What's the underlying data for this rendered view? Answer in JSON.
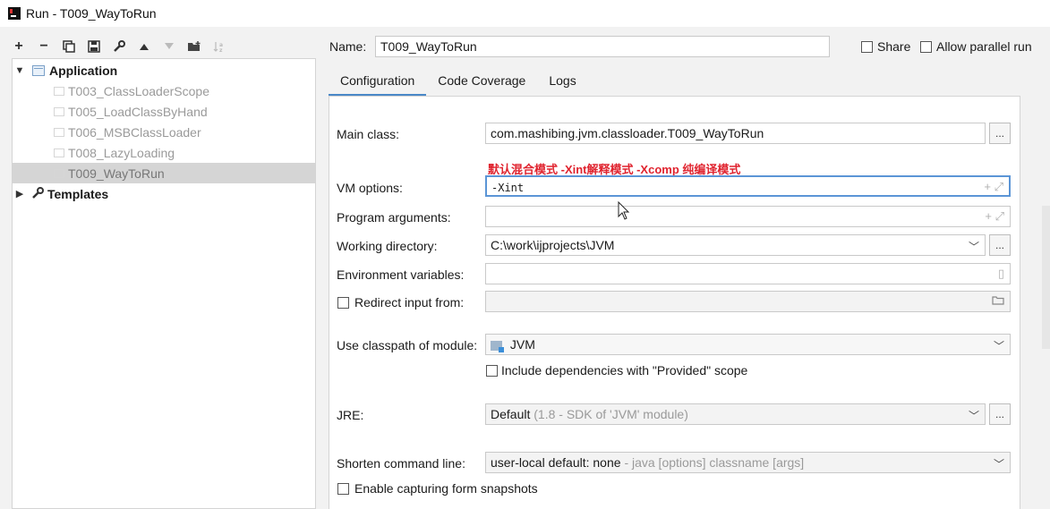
{
  "window": {
    "title": "Run - T009_WayToRun"
  },
  "toolbar": {
    "buttons": [
      "add",
      "remove",
      "copy",
      "save",
      "edit-defaults",
      "move-up",
      "move-down",
      "new-folder",
      "sort"
    ]
  },
  "tree": {
    "application_label": "Application",
    "items": [
      "T003_ClassLoaderScope",
      "T005_LoadClassByHand",
      "T006_MSBClassLoader",
      "T008_LazyLoading",
      "T009_WayToRun"
    ],
    "selected_index": 4,
    "templates_label": "Templates"
  },
  "header": {
    "name_label": "Name:",
    "name_value": "T009_WayToRun",
    "share_label": "Share",
    "share_checked": false,
    "parallel_label": "Allow parallel run",
    "parallel_checked": false
  },
  "tabs": [
    "Configuration",
    "Code Coverage",
    "Logs"
  ],
  "form": {
    "main_class_label": "Main class:",
    "main_class_value": "com.mashibing.jvm.classloader.T009_WayToRun",
    "annotation": "默认混合模式  -Xint解释模式 -Xcomp 纯编译模式",
    "vm_options_label": "VM options:",
    "vm_options_value": "-Xint",
    "program_args_label": "Program arguments:",
    "program_args_value": "",
    "working_dir_label": "Working directory:",
    "working_dir_value": "C:\\work\\ijprojects\\JVM",
    "env_vars_label": "Environment variables:",
    "env_vars_value": "",
    "redirect_label": "Redirect input from:",
    "redirect_checked": false,
    "classpath_label": "Use classpath of module:",
    "classpath_value": "JVM",
    "include_deps_label": "Include dependencies with \"Provided\" scope",
    "include_deps_checked": false,
    "jre_label": "JRE:",
    "jre_value": "Default",
    "jre_detail": "(1.8 - SDK of 'JVM' module)",
    "shorten_label": "Shorten command line:",
    "shorten_value": "user-local default: none",
    "shorten_detail": "- java [options] classname [args]",
    "snapshots_label": "Enable capturing form snapshots",
    "snapshots_checked": false,
    "browse_label": "...",
    "plus_label": "+"
  }
}
